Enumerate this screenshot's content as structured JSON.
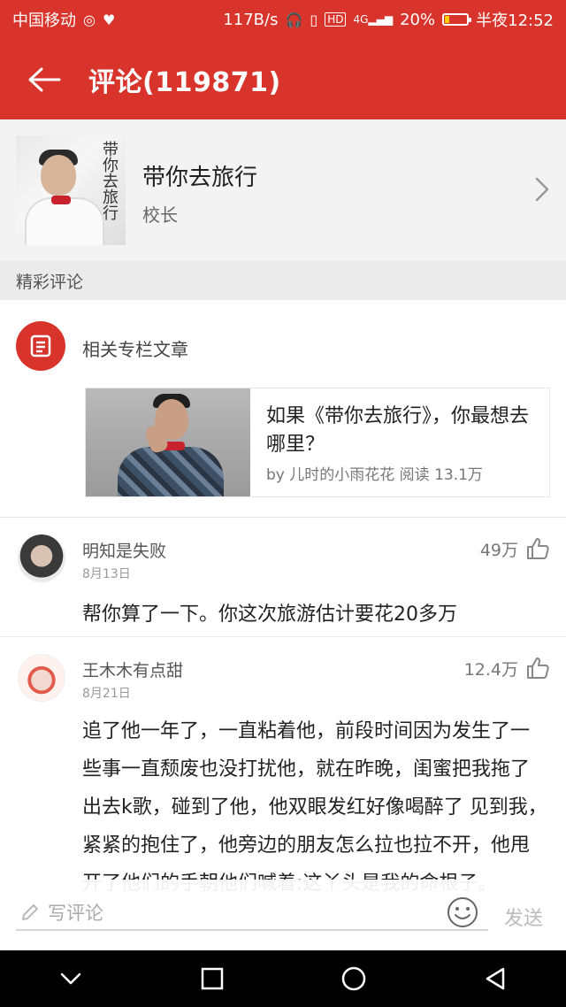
{
  "status_bar": {
    "carrier": "中国移动",
    "net_speed": "117B/s",
    "hd_label": "HD",
    "net_type": "4G",
    "battery": "20%",
    "time": "半夜12:52",
    "battery_level": 0.2
  },
  "header": {
    "title": "评论(119871)"
  },
  "song": {
    "cover_text": "带你去旅行",
    "name": "带你去旅行",
    "artist": "校长"
  },
  "section": {
    "title": "精彩评论"
  },
  "related": {
    "label": "相关专栏文章",
    "article": {
      "title": "如果《带你去旅行》，你最想去哪里？",
      "meta": "by 儿时的小雨花花  阅读 13.1万"
    }
  },
  "comments": [
    {
      "user": "明知是失败",
      "date": "8月13日",
      "likes": "49万",
      "text": "帮你算了一下。你这次旅游估计要花20多万"
    },
    {
      "user": "王木木有点甜",
      "date": "8月21日",
      "likes": "12.4万",
      "text": "追了他一年了，一直粘着他，前段时间因为发生了一些事一直颓废也没打扰他，就在昨晚，闺蜜把我拖了出去k歌，碰到了他，他双眼发红好像喝醉了 见到我，紧紧的抱住了，他旁边的朋友怎么拉也拉不开，他甩开了他们的手朝他们喊着:这丫头是我的命根子。"
    }
  ],
  "input": {
    "placeholder": "写评论",
    "send_label": "发送"
  },
  "colors": {
    "brand_red": "#d9342b"
  }
}
